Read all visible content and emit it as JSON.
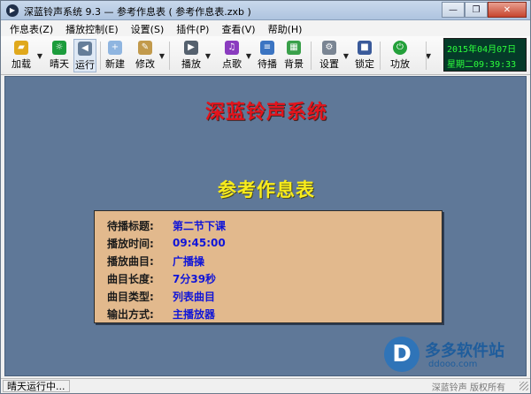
{
  "window": {
    "title": "深蓝铃声系统 9.3 — 参考作息表 ( 参考作息表.zxb )",
    "minimize_glyph": "—",
    "restore_glyph": "❐",
    "close_glyph": "✕"
  },
  "menu": [
    "作息表(Z)",
    "播放控制(E)",
    "设置(S)",
    "插件(P)",
    "查看(V)",
    "帮助(H)"
  ],
  "toolbar": {
    "load": "加载",
    "sunny": "晴天",
    "run": "运行",
    "new": "新建",
    "edit": "修改",
    "play": "播放",
    "song": "点歌",
    "standby": "待播",
    "background": "背景",
    "settings": "设置",
    "lock": "锁定",
    "amplifier": "功放"
  },
  "clock": {
    "date": "2015年04月07日",
    "time": "星期二09:39:33"
  },
  "main": {
    "system_title": "深蓝铃声系统",
    "schedule_title": "参考作息表",
    "info_rows": [
      {
        "label": "待播标题:",
        "value": "第二节下课"
      },
      {
        "label": "播放时间:",
        "value": "09:45:00"
      },
      {
        "label": "播放曲目:",
        "value": "广播操"
      },
      {
        "label": "曲目长度:",
        "value": "7分39秒"
      },
      {
        "label": "曲目类型:",
        "value": "列表曲目"
      },
      {
        "label": "输出方式:",
        "value": "主播放器"
      }
    ]
  },
  "watermark": {
    "logo_letter": "D",
    "text": "多多软件站",
    "url": "ddooo.com"
  },
  "status": {
    "left": "晴天运行中...",
    "right": "深蓝铃声  版权所有"
  },
  "colors": {
    "main_bg": "#5f7898",
    "system_title": "#e3141c",
    "schedule_title": "#f8ec1c",
    "info_bg": "#e2b98d",
    "value_text": "#1015d8",
    "clock_text": "#2cff3c"
  }
}
